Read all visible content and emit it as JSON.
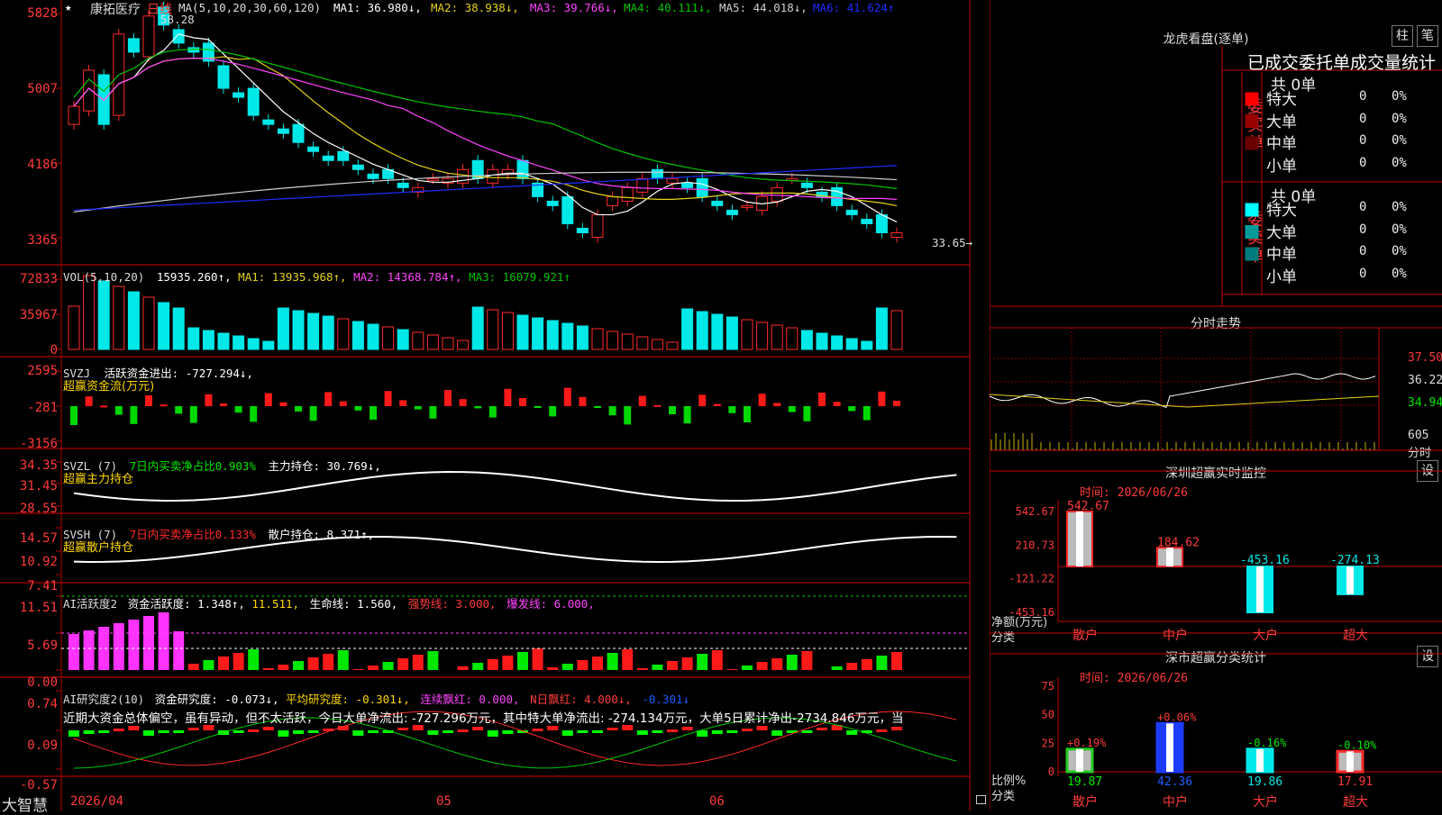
{
  "colors": {
    "up": "#ff2a2a",
    "down": "#00e8e8",
    "ma5": "#ffffff",
    "ma10": "#e6d21a",
    "ma20": "#ff44ff",
    "ma30": "#00c400",
    "ma60": "#cfcfcf",
    "ma120": "#1e2cff",
    "grid": "#9b0000"
  },
  "main": {
    "star": "★",
    "stock_name": "康拓医疗",
    "period": "日线",
    "ma_header": {
      "label": "MA(5,10,20,30,60,120)",
      "ma1": "MA1: 36.980↓,",
      "ma2": "MA2: 38.938↓,",
      "ma3": "MA3: 39.766↓,",
      "ma4": "MA4: 40.111↓,",
      "ma5": "MA5: 44.018↓,",
      "ma6": "MA6: 41.624↑"
    },
    "y_ticks": [
      "5828",
      "5007",
      "4186",
      "3365"
    ],
    "high_label": "58.28",
    "low_label": "33.65→",
    "date_labels": [
      "2026/04",
      "05",
      "06"
    ],
    "footer_label": "大智慧"
  },
  "vol": {
    "header_label": "VOL(5,10,20)",
    "value": "15935.260↑,",
    "ma1": "MA1: 13935.968↑,",
    "ma2": "MA2: 14368.784↑,",
    "ma3": "MA3: 16079.921↑",
    "y_ticks": [
      "72833",
      "35967",
      "0"
    ]
  },
  "svzj": {
    "header_label": "SVZJ",
    "title": "活跃资金进出: -727.294↓,",
    "subtitle": "超赢资金流(万元)",
    "y_ticks": [
      "2595",
      "-281",
      "-3156"
    ]
  },
  "svzl": {
    "header_label": "SVZL (7)",
    "ratio": "7日内买卖净占比0.903%",
    "position": "主力持仓: 30.769↓,",
    "subtitle": "超赢主力持仓",
    "y_ticks": [
      "34.35",
      "31.45",
      "28.55"
    ]
  },
  "svsh": {
    "header_label": "SVSH (7)",
    "ratio": "7日内买卖净占比0.133%",
    "position": "散户持仓: 8.371↑,",
    "subtitle": "超赢散户持仓",
    "y_ticks": [
      "14.57",
      "10.92",
      "7.41"
    ]
  },
  "ai_active": {
    "header_label": "AI活跃度2",
    "value": "资金活跃度: 1.348↑,",
    "v2": "11.511,",
    "life": "生命线: 1.560,",
    "strong": "强势线: 3.000,",
    "burst": "爆发线: 6.000,",
    "y_ticks": [
      "11.51",
      "5.69",
      "0.00"
    ]
  },
  "ai_research": {
    "header_label": "AI研究度2(10)",
    "value": "资金研究度: -0.073↓,",
    "avg": "平均研究度: -0.301↓,",
    "cont": "连续飘红: 0.000,",
    "nday": "N日飘红: 4.000↓,",
    "last": "-0.301↓",
    "commentary": "近期大资金总体偏空，虽有异动，但不太活跃，今日大单净流出: -727.296万元，其中特大单净流出: -274.134万元，大单5日累计净出-2734.846万元，当",
    "y_ticks": [
      "0.74",
      "0.09",
      "-0.57"
    ]
  },
  "dragon": {
    "title": "龙虎看盘(逐单)",
    "btn1": "柱",
    "btn2": "笔",
    "subtitle": "已成交委托单成交量统计",
    "buy": {
      "label": "委买单",
      "total": "共 0单",
      "rows": [
        {
          "name": "特大",
          "n": "0",
          "p": "0%",
          "color": "#ff0000"
        },
        {
          "name": "大单",
          "n": "0",
          "p": "0%",
          "color": "#9a0000"
        },
        {
          "name": "中单",
          "n": "0",
          "p": "0%",
          "color": "#6a0000"
        },
        {
          "name": "小单",
          "n": "0",
          "p": "0%",
          "color": "#000000"
        }
      ]
    },
    "sell": {
      "label": "委卖单",
      "total": "共 0单",
      "rows": [
        {
          "name": "特大",
          "n": "0",
          "p": "0%",
          "color": "#00ffff"
        },
        {
          "name": "大单",
          "n": "0",
          "p": "0%",
          "color": "#009a9a"
        },
        {
          "name": "中单",
          "n": "0",
          "p": "0%",
          "color": "#007a7a"
        },
        {
          "name": "小单",
          "n": "0",
          "p": "0%",
          "color": "#000000"
        }
      ]
    }
  },
  "intraday": {
    "title": "分时走势",
    "price_ticks": [
      "37.50",
      "36.22",
      "34.94"
    ],
    "vol_ticks": [
      "605",
      "分时"
    ]
  },
  "monitor": {
    "title": "深圳超赢实时监控",
    "btn": "设",
    "time": "时间: 2026/06/26",
    "y_ticks": [
      "542.67",
      "210.73",
      "-121.22",
      "-453.16"
    ],
    "axis_label": "净额(万元)",
    "axis_label2": "分类",
    "bars": [
      {
        "cat": "散户",
        "value": 542.67,
        "label": "542.67",
        "dir": "up"
      },
      {
        "cat": "中户",
        "value": 184.62,
        "label": "184.62",
        "dir": "up"
      },
      {
        "cat": "大户",
        "value": -453.16,
        "label": "-453.16",
        "dir": "down"
      },
      {
        "cat": "超大",
        "value": -274.13,
        "label": "-274.13",
        "dir": "down"
      }
    ]
  },
  "classify": {
    "title": "深市超赢分类统计",
    "btn": "设",
    "time": "时间: 2026/06/26",
    "y_ticks": [
      "75",
      "50",
      "25",
      "0"
    ],
    "axis_label": "比例%",
    "axis_label2": "分类",
    "bars": [
      {
        "cat": "散户",
        "value": 19.87,
        "label": "19.87",
        "chg": "+0.19%"
      },
      {
        "cat": "中户",
        "value": 42.36,
        "label": "42.36",
        "chg": "+0.06%"
      },
      {
        "cat": "大户",
        "value": 19.86,
        "label": "19.86",
        "chg": "-0.16%"
      },
      {
        "cat": "超大",
        "value": 17.91,
        "label": "17.91",
        "chg": "-0.10%"
      }
    ]
  }
}
